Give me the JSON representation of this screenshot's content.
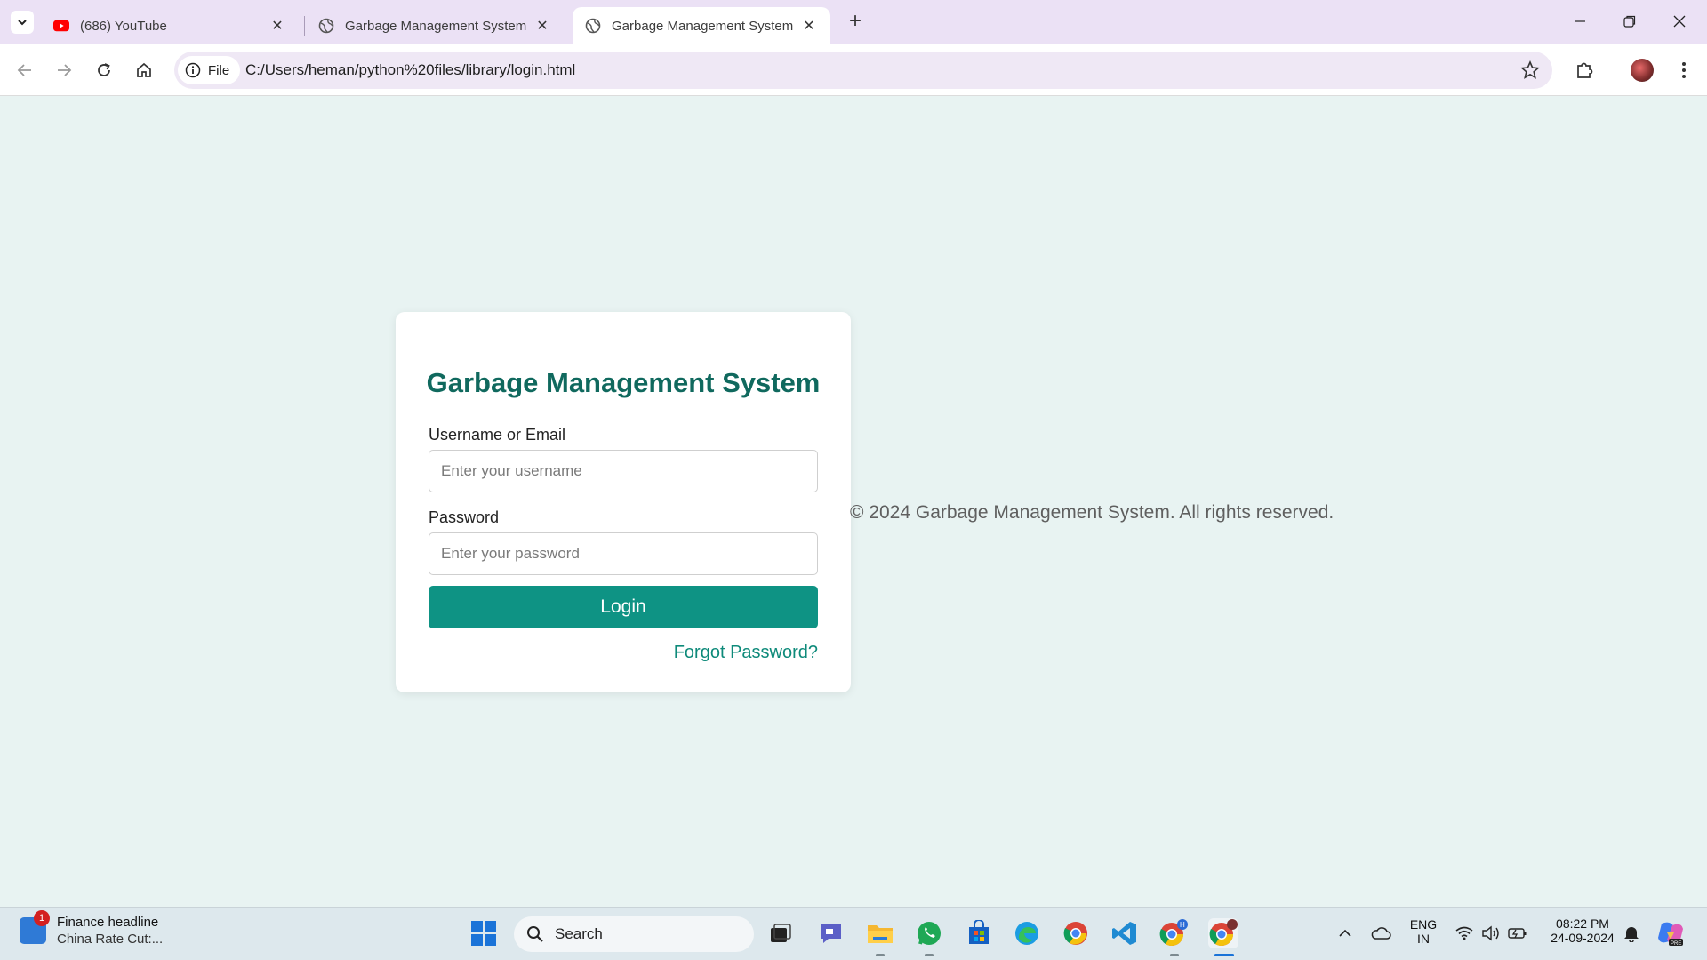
{
  "browser": {
    "tabs": [
      {
        "title": "(686) YouTube",
        "icon": "youtube-icon",
        "active": false
      },
      {
        "title": "Garbage Management System",
        "icon": "globe-icon",
        "active": false
      },
      {
        "title": "Garbage Management System",
        "icon": "globe-icon",
        "active": true
      }
    ],
    "address": {
      "chip_label": "File",
      "url": "C:/Users/heman/python%20files/library/login.html"
    }
  },
  "login": {
    "title": "Garbage Management System",
    "username_label": "Username or Email",
    "username_placeholder": "Enter your username",
    "username_value": "",
    "password_label": "Password",
    "password_placeholder": "Enter your password",
    "password_value": "",
    "login_label": "Login",
    "forgot_label": "Forgot Password?"
  },
  "footer": {
    "text": "© 2024 Garbage Management System. All rights reserved."
  },
  "taskbar": {
    "news_badge": "1",
    "news_headline": "Finance headline",
    "news_sub": "China Rate Cut:...",
    "search_label": "Search",
    "lang_top": "ENG",
    "lang_bottom": "IN",
    "time": "08:22 PM",
    "date": "24-09-2024"
  },
  "colors": {
    "accent": "#0e9384",
    "title": "#10695e",
    "page_bg": "#e8f3f2"
  }
}
